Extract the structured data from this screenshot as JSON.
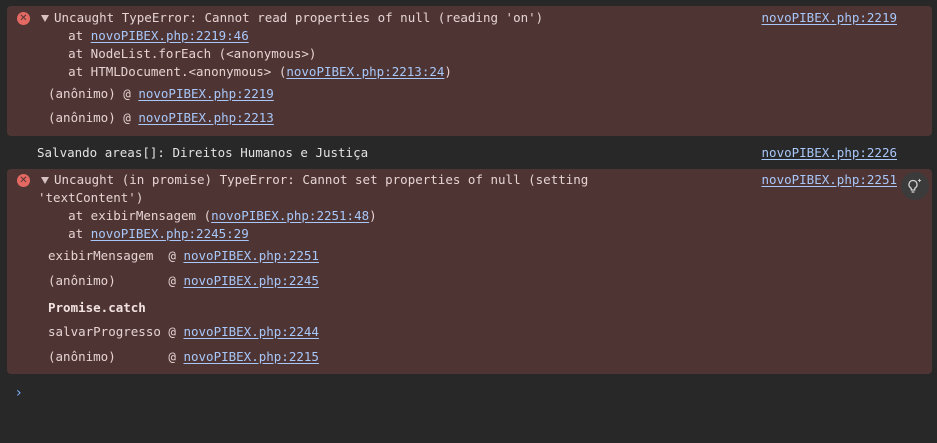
{
  "colors": {
    "background": "#282828",
    "error_bg": "#4e3534",
    "error_icon": "#e46962",
    "link": "#a8c7fa",
    "prompt": "#7cacf8"
  },
  "error1": {
    "icon": "error-circle-icon",
    "message": "Uncaught TypeError: Cannot read properties of null (reading 'on')",
    "source": "novoPIBEX.php:2219",
    "stack": [
      {
        "prefix": "    at ",
        "link": "novoPIBEX.php:2219:46",
        "suffix": ""
      },
      {
        "prefix": "    at NodeList.forEach (<anonymous>)",
        "link": "",
        "suffix": ""
      },
      {
        "prefix": "    at HTMLDocument.<anonymous> (",
        "link": "novoPIBEX.php:2213:24",
        "suffix": ")"
      }
    ],
    "frames": [
      {
        "fn": "(anônimo) @ ",
        "link": "novoPIBEX.php:2219"
      },
      {
        "fn": "(anônimo) @ ",
        "link": "novoPIBEX.php:2213"
      }
    ]
  },
  "log1": {
    "text": "Salvando areas[]: Direitos Humanos e Justiça",
    "source": "novoPIBEX.php:2226"
  },
  "error2": {
    "icon": "error-circle-icon",
    "message_line1": "Uncaught (in promise) TypeError: Cannot set properties of null (setting",
    "message_line2": "'textContent')",
    "source": "novoPIBEX.php:2251",
    "stack": [
      {
        "prefix": "    at exibirMensagem (",
        "link": "novoPIBEX.php:2251:48",
        "suffix": ")"
      },
      {
        "prefix": "    at ",
        "link": "novoPIBEX.php:2245:29",
        "suffix": ""
      }
    ],
    "frames": [
      {
        "fn": "exibirMensagem  @ ",
        "link": "novoPIBEX.php:2251"
      },
      {
        "fn": "(anônimo)       @ ",
        "link": "novoPIBEX.php:2245"
      },
      {
        "fn": "Promise.catch",
        "link": ""
      },
      {
        "fn": "salvarProgresso @ ",
        "link": "novoPIBEX.php:2244"
      },
      {
        "fn": "(anônimo)       @ ",
        "link": "novoPIBEX.php:2215"
      }
    ]
  },
  "ai_button": {
    "icon": "lightbulb-sparkle-icon"
  },
  "prompt": {
    "symbol": "›"
  }
}
